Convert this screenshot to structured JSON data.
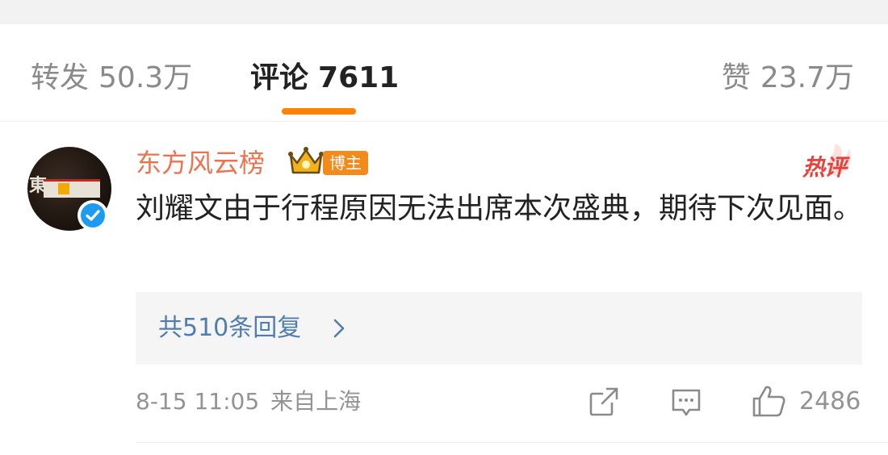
{
  "tabs": {
    "repost": {
      "label": "转发",
      "count": "50.3万"
    },
    "comments": {
      "label": "评论",
      "count": "7611"
    },
    "likes": {
      "label": "赞",
      "count": "23.7万"
    }
  },
  "comment": {
    "username": "东方风云榜",
    "badge": "博主",
    "hot_label": "热评",
    "text": "刘耀文由于行程原因无法出席本次盛典，期待下次见面。",
    "replies_link": "共510条回复",
    "date": "8-15 11:05",
    "source": "来自上海",
    "like_count": "2486",
    "avatar_glyph": "東"
  },
  "colors": {
    "accent": "#ff8200",
    "username": "#eb7350",
    "link": "#507daf",
    "hot": "#e8423f",
    "verified": "#1d9bf0"
  },
  "icons": [
    "crown-icon",
    "verified-icon",
    "chevron-right-icon",
    "share-icon",
    "comment-icon",
    "like-icon"
  ]
}
